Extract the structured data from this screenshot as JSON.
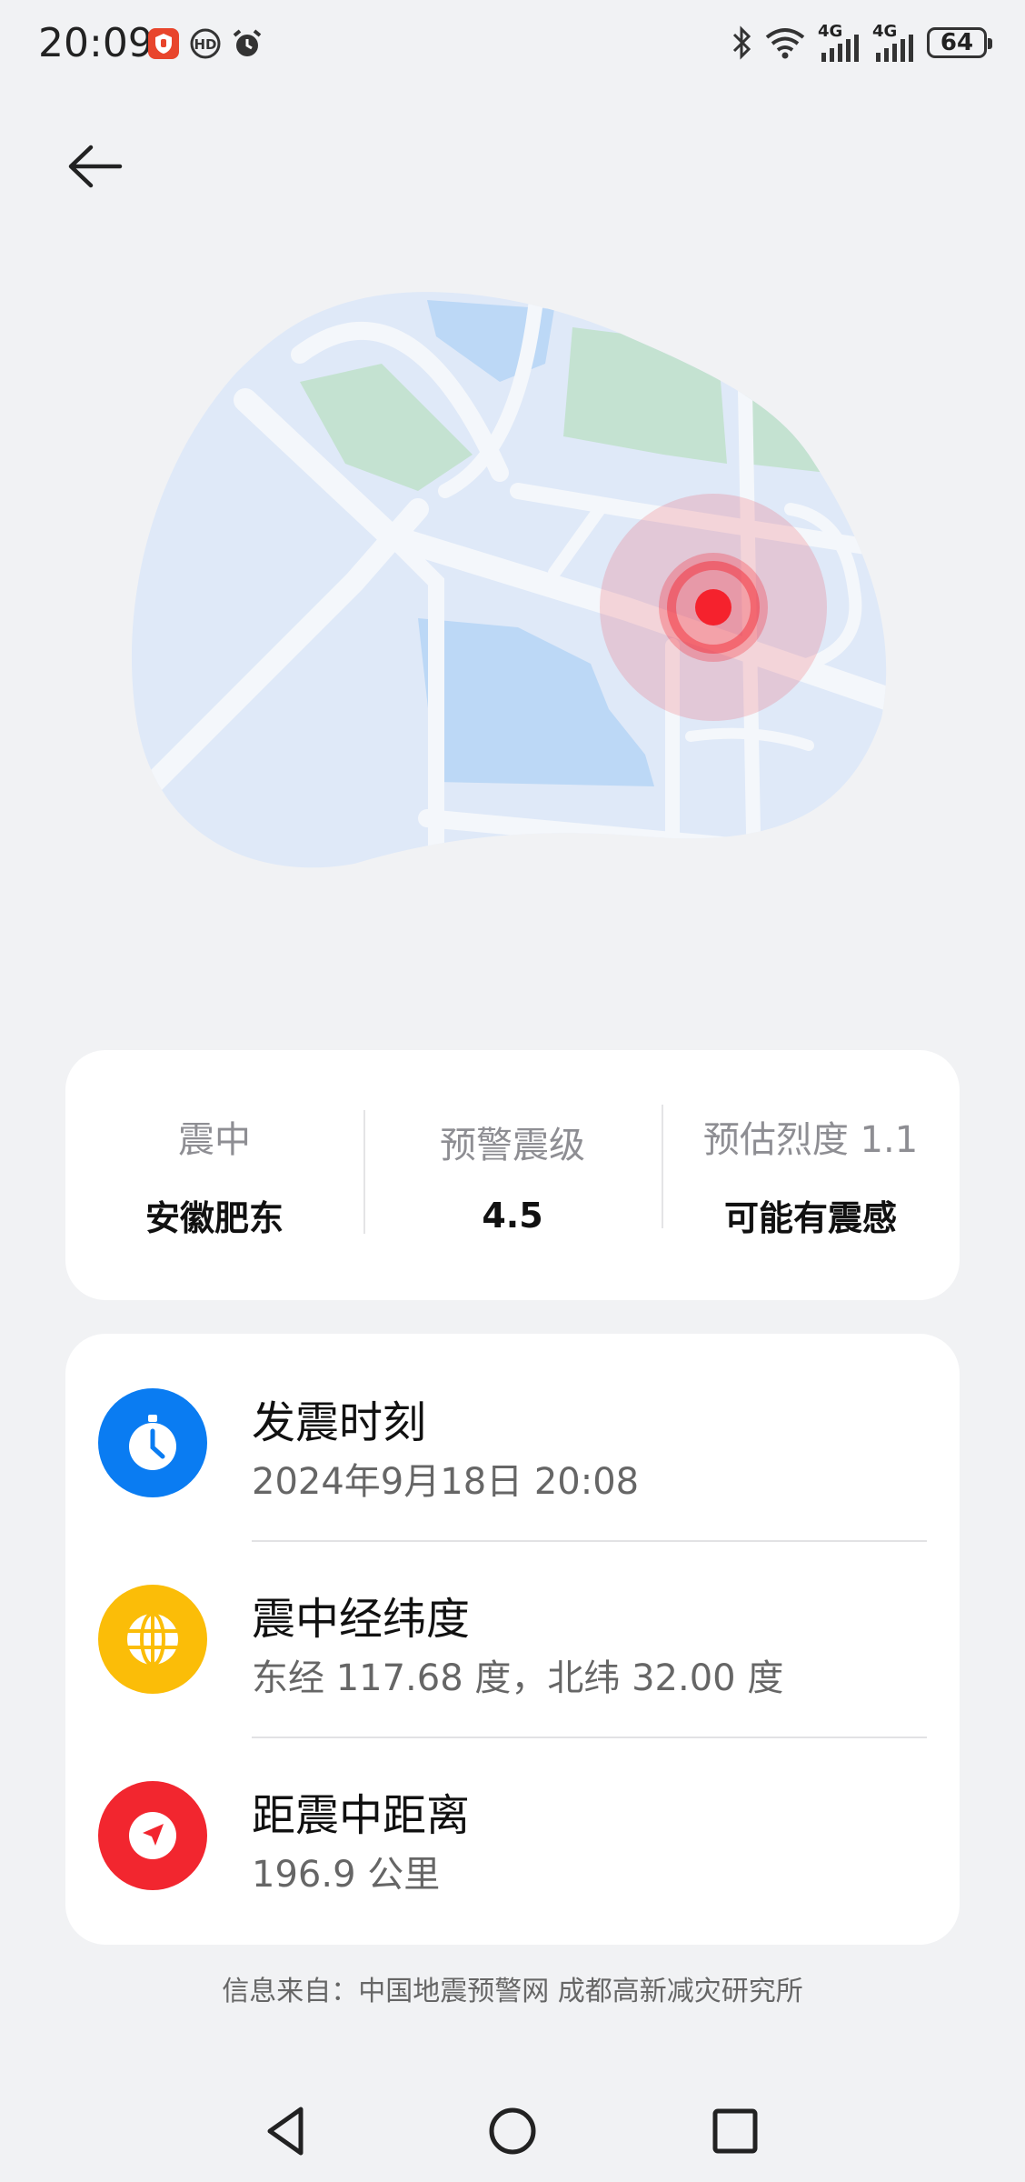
{
  "status_bar": {
    "time": "20:09",
    "network_1": "4G",
    "network_2": "4G",
    "battery": "64",
    "icons": [
      "app-badge-icon",
      "hd-call-icon",
      "alarm-icon",
      "bluetooth-icon",
      "wifi-icon",
      "signal-icon",
      "battery-icon"
    ]
  },
  "header": {
    "back_icon": "arrow-left-icon"
  },
  "map": {
    "marker_color": "#f5222d"
  },
  "summary": {
    "epicenter_label": "震中",
    "epicenter_value": "安徽肥东",
    "magnitude_label": "预警震级",
    "magnitude_value": "4.5",
    "intensity_label": "预估烈度 1.1",
    "intensity_value": "可能有震感"
  },
  "details": [
    {
      "title": "发震时刻",
      "value": "2024年9月18日 20:08",
      "icon": "clock-icon",
      "color": "#0a7cf2"
    },
    {
      "title": "震中经纬度",
      "value": "东经 117.68 度，北纬 32.00 度",
      "icon": "globe-icon",
      "color": "#fbbd08"
    },
    {
      "title": "距震中距离",
      "value": "196.9 公里",
      "icon": "navigation-icon",
      "color": "#f2262f"
    }
  ],
  "source": "信息来自：中国地震预警网 成都高新减灾研究所",
  "nav": {
    "back": "nav-back-icon",
    "home": "nav-home-icon",
    "recent": "nav-recent-icon"
  }
}
